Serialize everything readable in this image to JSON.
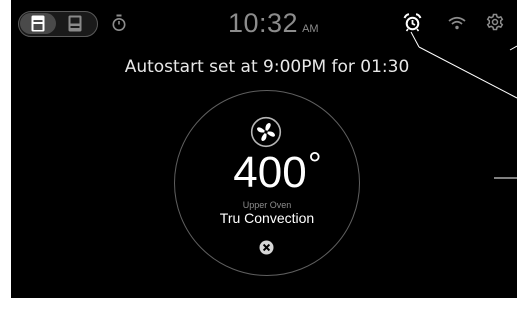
{
  "status_bar": {
    "oven_selector": [
      {
        "name": "upper-oven",
        "selected": true
      },
      {
        "name": "lower-oven",
        "selected": false
      }
    ],
    "timer_icon": "stopwatch-icon",
    "clock_time": "10:32",
    "clock_ampm": "AM",
    "alarm_icon": "alarm-clock-icon",
    "wifi_icon": "wifi-icon",
    "settings_icon": "gear-icon"
  },
  "autostart_message": "Autostart set at 9:00PM for 01:30",
  "cook_mode": {
    "icon": "convection-fan-icon",
    "temperature": "400",
    "degree_symbol": "°",
    "oven": "Upper Oven",
    "mode": "Tru Convection",
    "cancel_icon": "close-circle-icon"
  },
  "colors": {
    "background": "#000000",
    "primary_text": "#ffffff",
    "secondary_text": "#8c8c8c",
    "circle_border": "#5f5f5f",
    "callout_line": "#ffffff"
  }
}
